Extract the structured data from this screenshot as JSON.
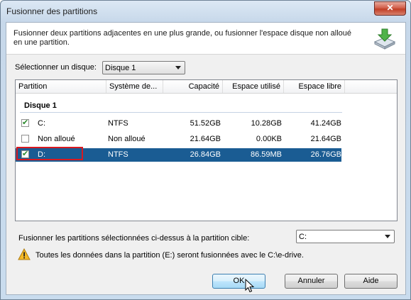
{
  "window": {
    "title": "Fusionner des partitions",
    "close_label": "✕"
  },
  "description": "Fusionner deux partitions adjacentes en une plus grande, ou fusionner l'espace disque non alloué en une partition.",
  "disk_selector": {
    "label": "Sélectionner un disque:",
    "value": "Disque 1"
  },
  "table": {
    "columns": [
      "Partition",
      "Système de...",
      "Capacité",
      "Espace utilisé",
      "Espace libre"
    ],
    "group": "Disque 1",
    "rows": [
      {
        "checked": true,
        "partition": "C:",
        "fs": "NTFS",
        "capacity": "51.52GB",
        "used": "10.28GB",
        "free": "41.24GB",
        "selected": false
      },
      {
        "checked": false,
        "partition": "Non alloué",
        "fs": "Non alloué",
        "capacity": "21.64GB",
        "used": "0.00KB",
        "free": "21.64GB",
        "selected": false
      },
      {
        "checked": true,
        "partition": "D:",
        "fs": "NTFS",
        "capacity": "26.84GB",
        "used": "86.59MB",
        "free": "26.76GB",
        "selected": true
      }
    ]
  },
  "target": {
    "label": "Fusionner les partitions sélectionnées ci-dessus à la partition cible:",
    "value": "C:"
  },
  "warning": "Toutes les données dans la partition (E:) seront fusionnées avec le C:\\e-drive.",
  "buttons": {
    "ok": "OK",
    "cancel": "Annuler",
    "help": "Aide"
  },
  "colors": {
    "selection": "#1a5c93",
    "highlight": "#d71920",
    "checkmark": "#2d8a2d"
  }
}
